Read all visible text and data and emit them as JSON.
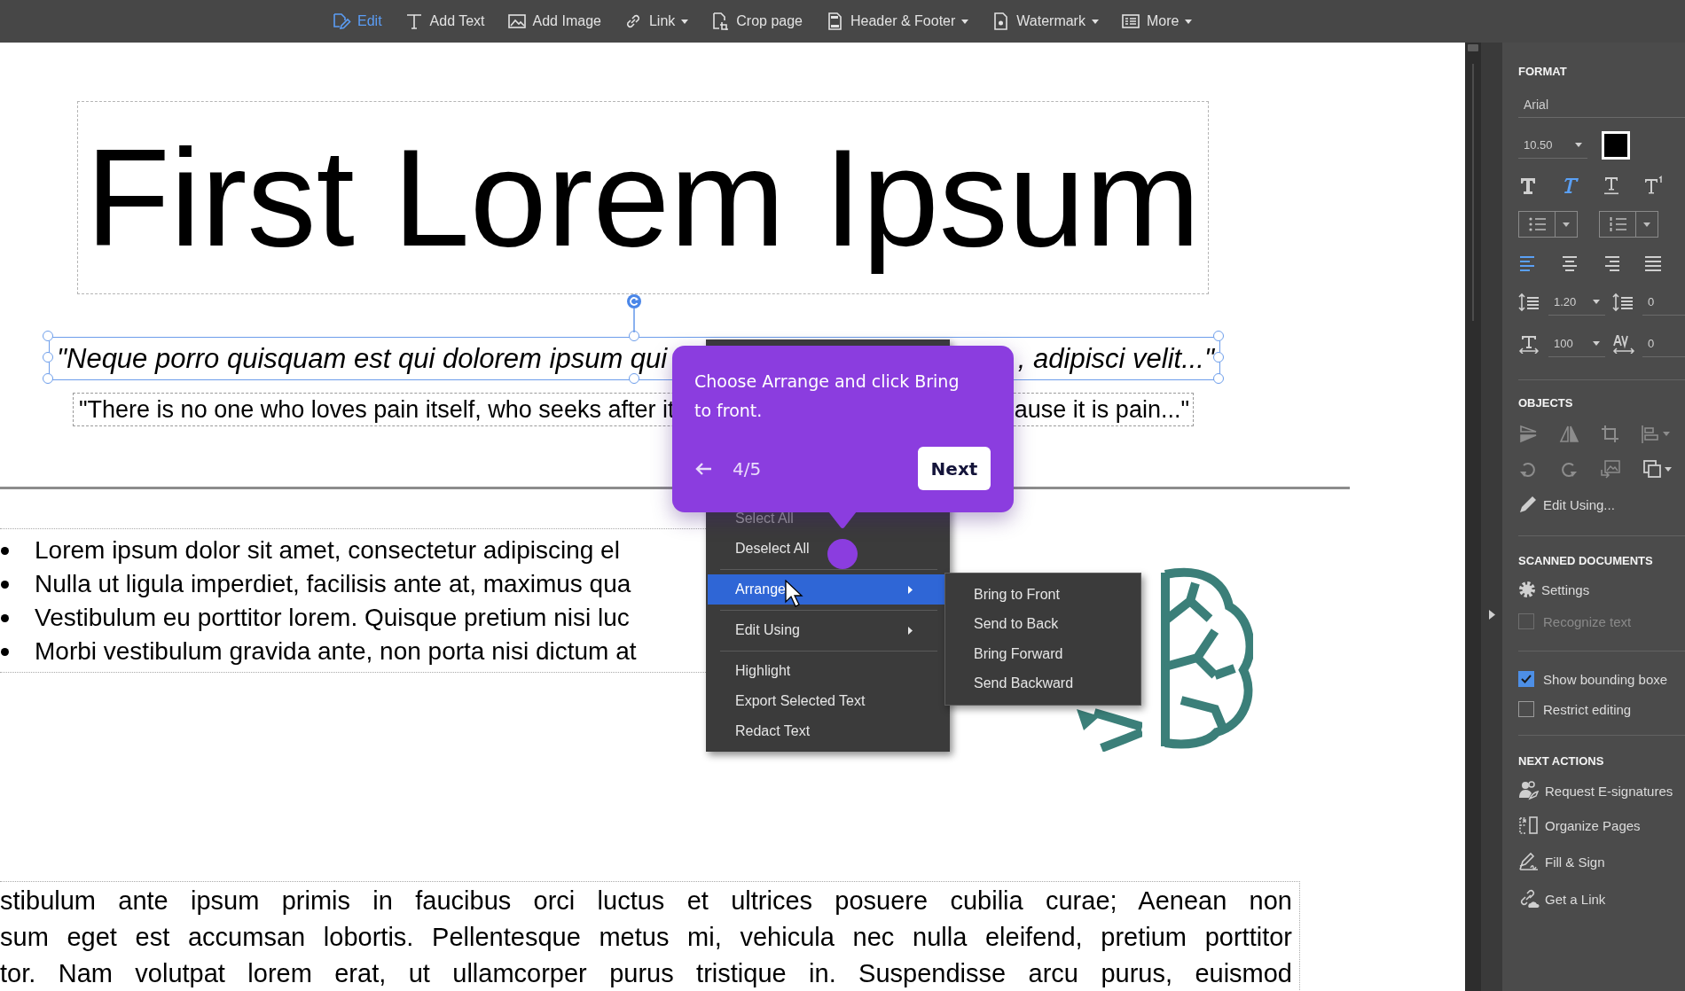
{
  "toolbar": {
    "items": [
      {
        "label": "Edit",
        "selected": true,
        "dropdown": false
      },
      {
        "label": "Add Text",
        "selected": false,
        "dropdown": false
      },
      {
        "label": "Add Image",
        "selected": false,
        "dropdown": false
      },
      {
        "label": "Link",
        "selected": false,
        "dropdown": true
      },
      {
        "label": "Crop page",
        "selected": false,
        "dropdown": false
      },
      {
        "label": "Header & Footer",
        "selected": false,
        "dropdown": true
      },
      {
        "label": "Watermark",
        "selected": false,
        "dropdown": true
      },
      {
        "label": "More",
        "selected": false,
        "dropdown": true
      }
    ]
  },
  "document": {
    "title": "First Lorem Ipsum",
    "selected_line": {
      "left": "\"Neque porro quisquam est qui dolorem ipsum qui",
      "right": ", adipisci velit...\""
    },
    "quote_line": {
      "left": "\"There is no one who loves pain itself, who seeks after it",
      "right": "ause it is pain...\""
    },
    "bullets": [
      "Lorem ipsum dolor sit amet, consectetur adipiscing el",
      "Nulla ut ligula imperdiet, facilisis ante at, maximus qua",
      "Vestibulum eu porttitor lorem. Quisque pretium nisi luc",
      "Morbi vestibulum gravida ante, non porta nisi dictum at"
    ],
    "paragraph_lines": [
      "stibulum ante ipsum primis in faucibus orci luctus et ultrices posuere cubilia curae; Aenean non",
      "sum eget est accumsan lobortis. Pellentesque metus mi, vehicula nec nulla eleifend, pretium porttitor",
      "tor. Nam volutpat lorem erat, ut ullamcorper purus tristique in. Suspendisse arcu purus, euismod"
    ]
  },
  "context_menu": {
    "items": [
      {
        "kind": "item",
        "label": "Select All",
        "selected": false,
        "disabled": true,
        "submenu": false
      },
      {
        "kind": "item",
        "label": "Deselect All",
        "selected": false,
        "disabled": false,
        "submenu": false
      },
      {
        "kind": "separator"
      },
      {
        "kind": "item",
        "label": "Arrange",
        "selected": true,
        "disabled": false,
        "submenu": true
      },
      {
        "kind": "separator"
      },
      {
        "kind": "item",
        "label": "Edit Using",
        "selected": false,
        "disabled": false,
        "submenu": true
      },
      {
        "kind": "separator"
      },
      {
        "kind": "item",
        "label": "Highlight",
        "selected": false,
        "disabled": false,
        "submenu": false
      },
      {
        "kind": "item",
        "label": "Export Selected Text",
        "selected": false,
        "disabled": false,
        "submenu": false
      },
      {
        "kind": "item",
        "label": "Redact Text",
        "selected": false,
        "disabled": false,
        "submenu": false
      }
    ]
  },
  "submenu": {
    "items": [
      "Bring to Front",
      "Send to Back",
      "Bring Forward",
      "Send Backward"
    ]
  },
  "tour": {
    "text": "Choose Arrange and click Bring to front.",
    "step": "4/5",
    "next": "Next"
  },
  "format_panel": {
    "heading": "FORMAT",
    "font": "Arial",
    "font_size": "10.50",
    "color": "#000000",
    "text_styles": [
      {
        "selected": false
      },
      {
        "selected": true
      },
      {
        "selected": false
      },
      {
        "selected": false
      }
    ],
    "alignment": [
      {
        "selected": true
      },
      {
        "selected": false
      },
      {
        "selected": false
      },
      {
        "selected": false
      }
    ],
    "line_spacing": "1.20",
    "paragraph_spacing": "0",
    "text_scale": "100",
    "character_spacing": "0"
  },
  "objects_panel": {
    "heading": "OBJECTS",
    "edit_using": "Edit Using..."
  },
  "scanned_documents": {
    "heading": "SCANNED DOCUMENTS",
    "settings": "Settings",
    "recognize_text": {
      "label": "Recognize text",
      "checked": false,
      "disabled": true
    }
  },
  "options": [
    {
      "label": "Show bounding boxe",
      "checked": true
    },
    {
      "label": "Restrict editing",
      "checked": false
    }
  ],
  "next_actions": {
    "heading": "NEXT ACTIONS",
    "items": [
      "Request E-signatures",
      "Organize Pages",
      "Fill & Sign",
      "Get a Link"
    ]
  }
}
